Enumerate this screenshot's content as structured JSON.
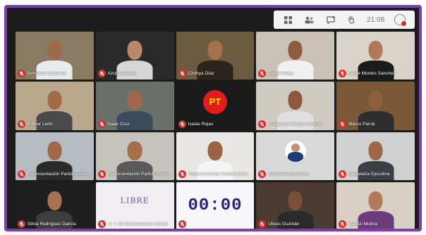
{
  "toolbar": {
    "icons": [
      "grid-view-icon",
      "participants-icon",
      "chat-icon",
      "raise-hand-icon"
    ],
    "clock": "21:08"
  },
  "colors": {
    "frame": "#7b3fb0",
    "mic_muted": "#d32f2f",
    "pt_red": "#e21c1c",
    "pt_yellow": "#ffe600"
  },
  "participants": [
    {
      "name": "Armando Gutiérrez",
      "bg": "#8a7a62",
      "skin": "#9c6b4c",
      "shirt": "#e8ecef"
    },
    {
      "name": "Azul Camargo",
      "bg": "#2a2a2a",
      "skin": "#b98866",
      "shirt": "#d6d6d6"
    },
    {
      "name": "Cinthya Díaz",
      "bg": "#6e5a3e",
      "skin": "#a3714e",
      "shirt": "#2d241c"
    },
    {
      "name": "Daniel Moya",
      "bg": "#c9c2b5",
      "skin": "#8e5b3c",
      "shirt": "#f0f0f0"
    },
    {
      "name": "Dulce Montes Sánchez",
      "bg": "#d9d3ca",
      "skin": "#b07a5a",
      "shirt": "#1b1b1b"
    },
    {
      "name": "Edmar León",
      "bg": "#b9a88c",
      "skin": "#a26c4a",
      "shirt": "#4a4a4a"
    },
    {
      "name": "Isaac Cruz",
      "bg": "#6a6f6a",
      "skin": "#a06848",
      "shirt": "#3b4a5c"
    },
    {
      "name": "Isaías Rojas",
      "bg": "#1a1a1a",
      "logo": "PT"
    },
    {
      "name": "J. Nazario Vargas Armenta",
      "bg": "#cfcac2",
      "skin": "#8c5a3a",
      "shirt": "#e0e0e0"
    },
    {
      "name": "Marco Parral",
      "bg": "#7a5838",
      "skin": "#8e5e3e",
      "shirt": "#2e2e2e"
    },
    {
      "name": "Representación Partido Redes Soc...",
      "bg": "#b7bbc2",
      "skin": "#9e6a4a",
      "shirt": "#2b2b2b"
    },
    {
      "name": "Representación Partido Revoluci...",
      "bg": "#c6c3bd",
      "skin": "#a56f4c",
      "shirt": "#5a5a5a"
    },
    {
      "name": "Representación Partido Movimien...",
      "bg": "#e9e7e4",
      "skin": "#9a6444",
      "shirt": "#f4f4f4"
    },
    {
      "name": "Secretaría Ejecutiva",
      "bg": "#d9d9d9",
      "avatar": true
    },
    {
      "name": "Secretaría Ejecutiva",
      "bg": "#cfd0cf",
      "skin": "#9a6848",
      "shirt": "#3b3f45"
    },
    {
      "name": "Silvia Rodríguez García",
      "bg": "#1f1f1f",
      "skin": "#a67452",
      "shirt": "#3e3e3e"
    },
    {
      "name": "U. T. de Comunicación Social",
      "bg": "#f0eef2",
      "libre": "LIBRE"
    },
    {
      "name": "",
      "bg": "#f7f7fb",
      "timer": "00:00"
    },
    {
      "name": "Ulises Guzmán",
      "bg": "#4b3b30",
      "skin": "#7b5038",
      "shirt": "#2a2a2a"
    },
    {
      "name": "Yaretzi Molina",
      "bg": "#d8cfc5",
      "skin": "#b07b5b",
      "shirt": "#6e3b7a"
    }
  ]
}
